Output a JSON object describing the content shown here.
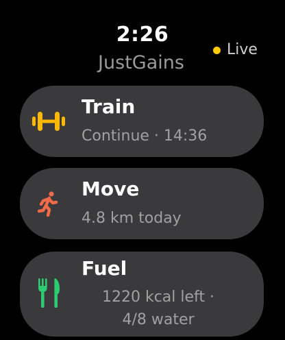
{
  "status": {
    "time": "2:26",
    "live_label": "Live",
    "live_color": "#ffcc00"
  },
  "app": {
    "title": "JustGains"
  },
  "cards": [
    {
      "id": "train",
      "title": "Train",
      "subtitle": "Continue · 14:36",
      "icon": "dumbbell-icon",
      "icon_color": "#ffb800"
    },
    {
      "id": "move",
      "title": "Move",
      "subtitle": "4.8 km today",
      "icon": "running-person-icon",
      "icon_color": "#f06a4a"
    },
    {
      "id": "fuel",
      "title": "Fuel",
      "subtitle_line1": "1220 kcal left ·",
      "subtitle_line2": "4/8 water",
      "icon": "fork-knife-icon",
      "icon_color": "#2ecc71"
    }
  ]
}
